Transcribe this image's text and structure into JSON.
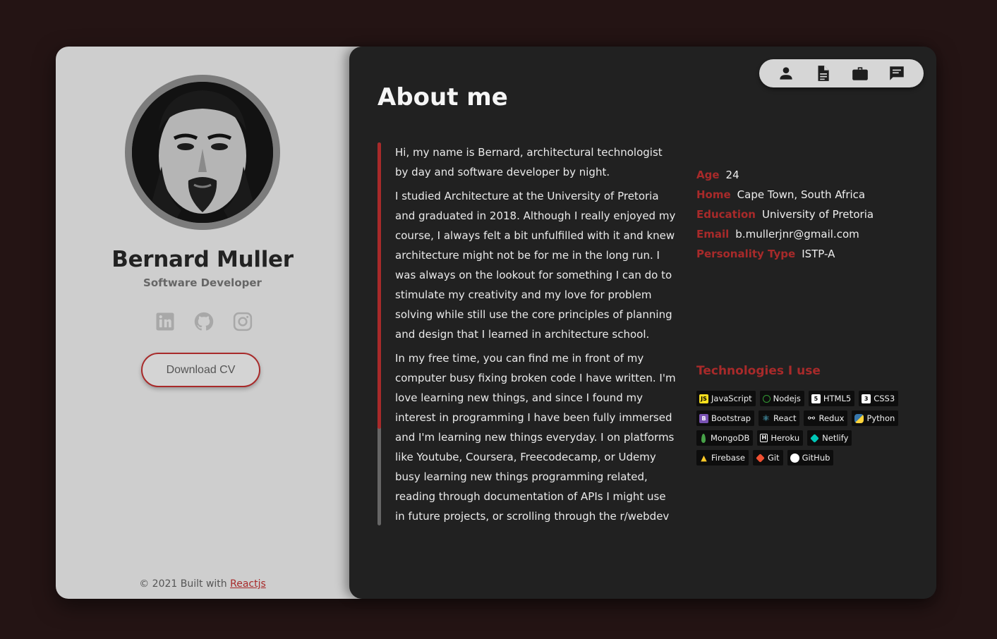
{
  "profile": {
    "name": "Bernard Muller",
    "role": "Software Developer",
    "download_label": "Download CV",
    "footer_prefix": "© 2021 Built with",
    "footer_link": "Reactjs",
    "socials": [
      "linkedin-icon",
      "github-icon",
      "instagram-icon"
    ]
  },
  "nav": {
    "icons": [
      "person-icon",
      "document-icon",
      "briefcase-icon",
      "chat-icon"
    ]
  },
  "about": {
    "title": "About me",
    "paragraphs": [
      "Hi, my name is Bernard, architectural technologist by day and software developer by night.",
      "I studied Architecture at the University of Pretoria and graduated in 2018. Although I really enjoyed my course, I always felt a bit unfulfilled with it and knew architecture might not be for me in the long run. I was always on the lookout for something I can do to stimulate my creativity and my love for problem solving while still use the core principles of planning and design that I learned in architecture school.",
      "In my free time, you can find me in front of my computer busy fixing broken code I have written. I'm love learning new things, and since I found my interest in programming I have been fully immersed and I'm learning new things everyday. I on platforms like Youtube, Coursera, Freecodecamp, or Udemy busy learning new things programming related, reading through documentation of APIs I might use in future projects, or scrolling through the r/webdev subreddit"
    ]
  },
  "info": [
    {
      "key": "Age",
      "value": "24"
    },
    {
      "key": "Home",
      "value": "Cape Town, South Africa"
    },
    {
      "key": "Education",
      "value": "University of Pretoria"
    },
    {
      "key": "Email",
      "value": "b.mullerjnr@gmail.com"
    },
    {
      "key": "Personality Type",
      "value": "ISTP-A"
    }
  ],
  "technologies": {
    "title": "Technologies I use",
    "rows": [
      [
        {
          "label": "JavaScript",
          "icon": "javascript-icon",
          "color": "#f7df1e"
        },
        {
          "label": "Nodejs",
          "icon": "nodejs-icon",
          "color": "#339933"
        },
        {
          "label": "HTML5",
          "icon": "html5-icon",
          "color": "#ffffff"
        },
        {
          "label": "CSS3",
          "icon": "css3-icon",
          "color": "#ffffff"
        }
      ],
      [
        {
          "label": "Bootstrap",
          "icon": "bootstrap-icon",
          "color": "#7952b3"
        },
        {
          "label": "React",
          "icon": "react-icon",
          "color": "#61dafb"
        },
        {
          "label": "Redux",
          "icon": "redux-icon",
          "color": "#ffffff"
        },
        {
          "label": "Python",
          "icon": "python-icon",
          "color": "#3776ab"
        }
      ],
      [
        {
          "label": "MongoDB",
          "icon": "mongodb-icon",
          "color": "#47a248"
        },
        {
          "label": "Heroku",
          "icon": "heroku-icon",
          "color": "#ffffff"
        },
        {
          "label": "Netlify",
          "icon": "netlify-icon",
          "color": "#00c7b7"
        }
      ],
      [
        {
          "label": "Firebase",
          "icon": "firebase-icon",
          "color": "#ffca28"
        },
        {
          "label": "Git",
          "icon": "git-icon",
          "color": "#f05032"
        },
        {
          "label": "GitHub",
          "icon": "github-icon",
          "color": "#ffffff"
        }
      ]
    ]
  },
  "colors": {
    "accent": "#a82a2a",
    "page_bg": "#241414",
    "left_bg": "#cecece",
    "right_bg": "#212121"
  }
}
